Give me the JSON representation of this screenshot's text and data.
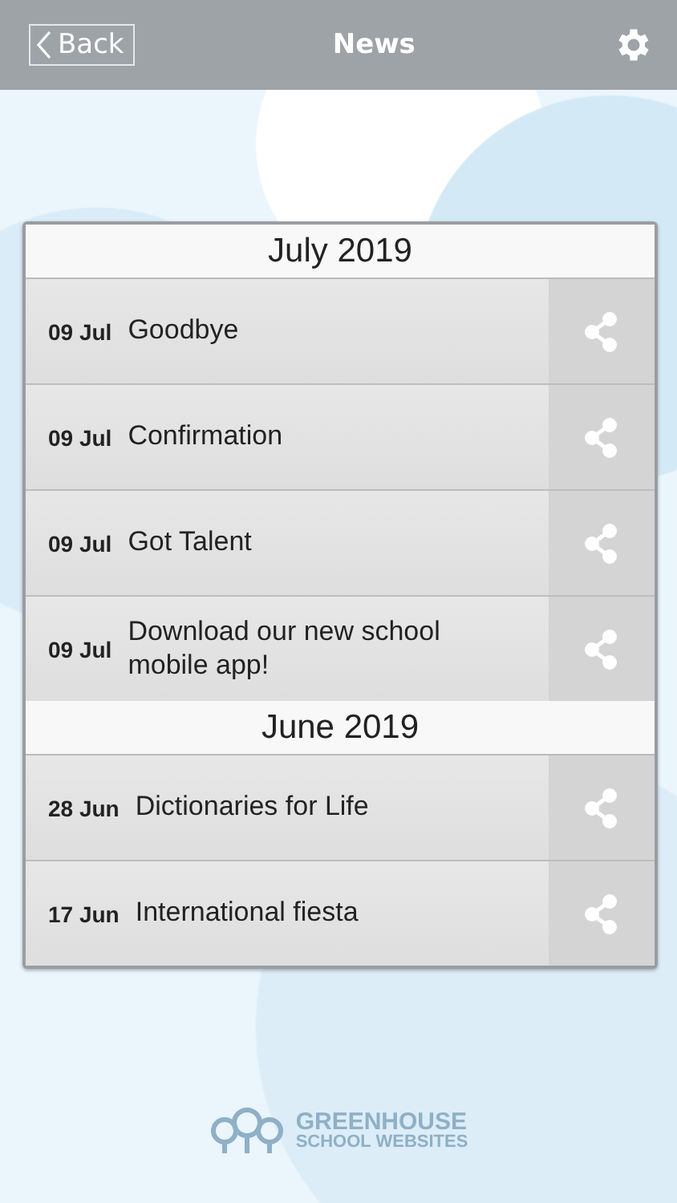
{
  "header": {
    "back": "Back",
    "title": "News"
  },
  "sections": [
    {
      "title": "July 2019",
      "items": [
        {
          "date": "09 Jul",
          "title": "Goodbye"
        },
        {
          "date": "09 Jul",
          "title": "Confirmation"
        },
        {
          "date": "09 Jul",
          "title": "Got Talent"
        },
        {
          "date": "09 Jul",
          "title": "Download our new school mobile app!"
        }
      ]
    },
    {
      "title": "June 2019",
      "items": [
        {
          "date": "28 Jun",
          "title": "Dictionaries for Life"
        },
        {
          "date": "17 Jun",
          "title": "International fiesta"
        }
      ]
    }
  ],
  "footer": {
    "brand_line_1": "GREENHOUSE",
    "brand_line_2": "SCHOOL WEBSITES"
  }
}
